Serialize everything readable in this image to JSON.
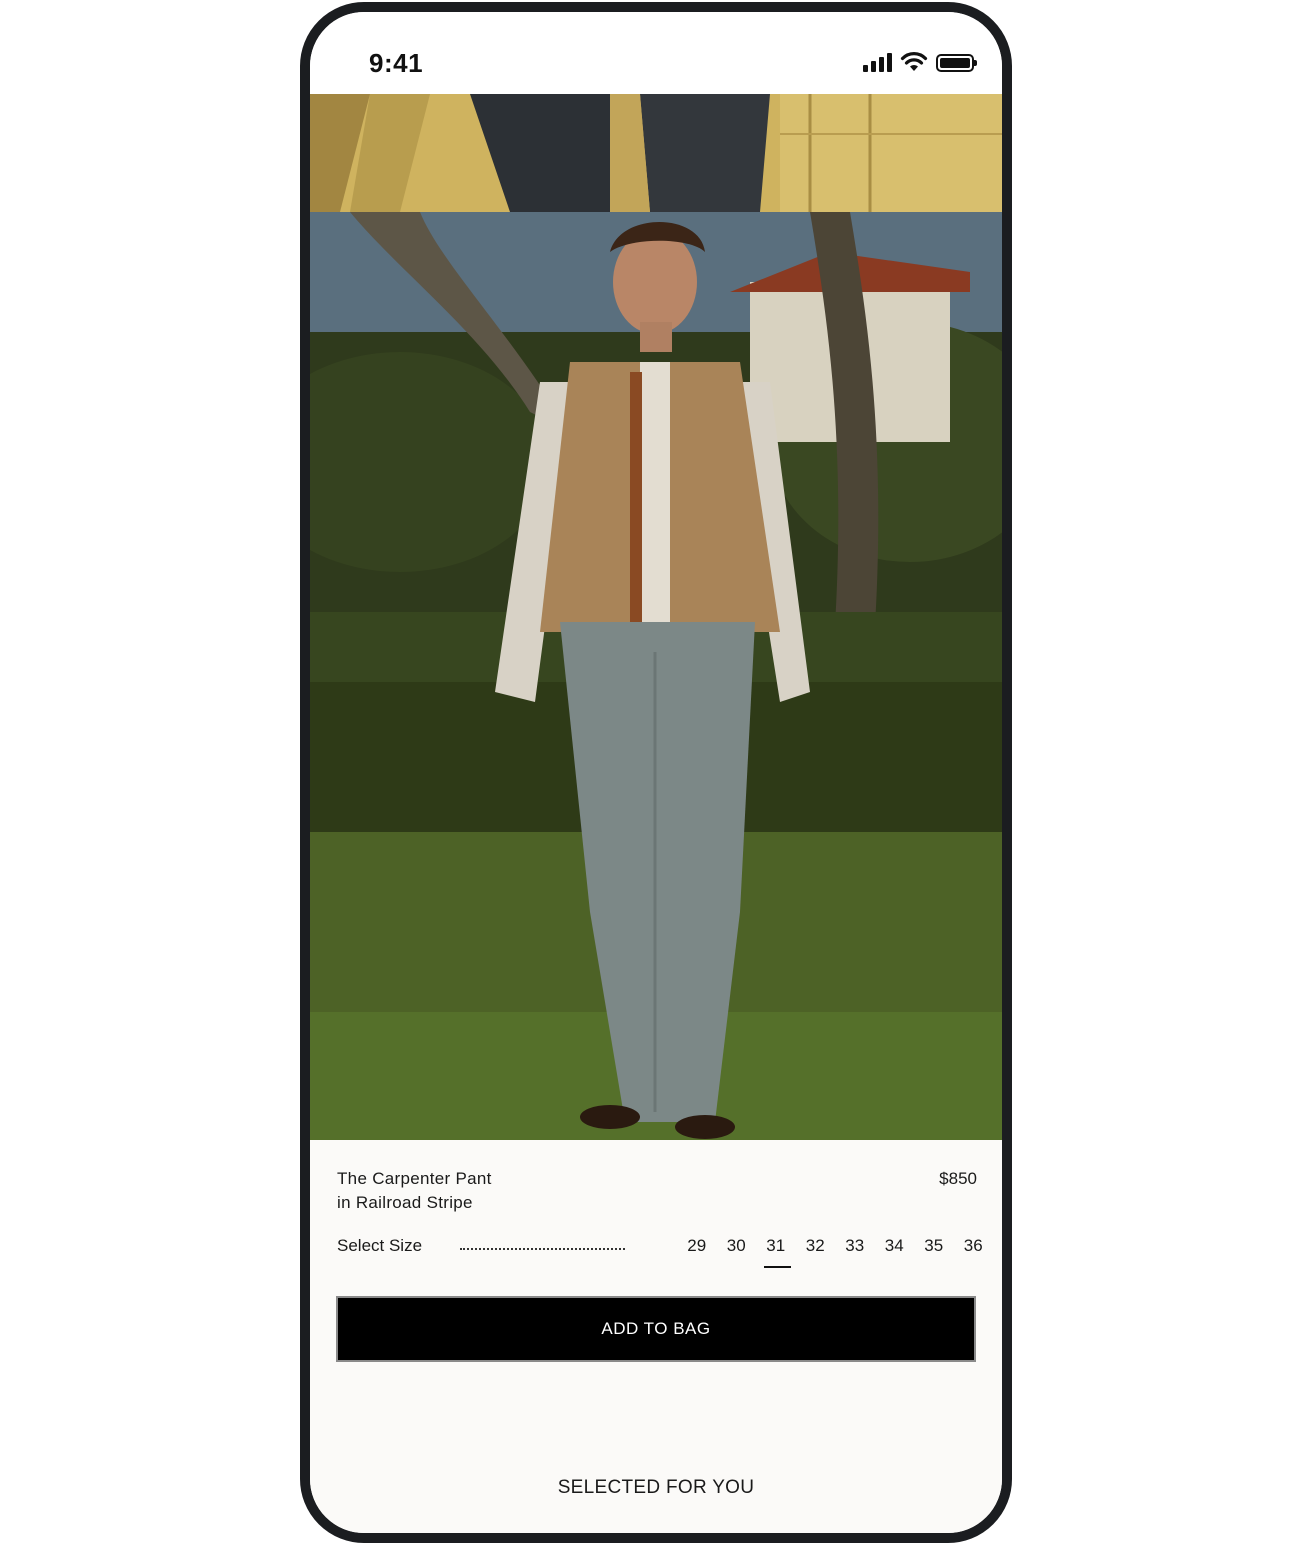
{
  "status_bar": {
    "time": "9:41",
    "icons": [
      "cellular-signal-icon",
      "wifi-icon",
      "battery-icon"
    ]
  },
  "gallery": {
    "images": [
      {
        "name": "product-photo-detail",
        "description_icon": "photo"
      },
      {
        "name": "product-photo-model",
        "description_icon": "photo"
      }
    ]
  },
  "product": {
    "name_line1": "The Carpenter Pant",
    "name_line2": "in Railroad Stripe",
    "price": "$850"
  },
  "size_selector": {
    "label": "Select Size",
    "sizes": [
      "29",
      "30",
      "31",
      "32",
      "33",
      "34",
      "35",
      "36"
    ],
    "selected": "31"
  },
  "actions": {
    "add_to_bag": "ADD TO BAG"
  },
  "sections": {
    "selected_for_you": "SELECTED FOR YOU"
  },
  "colors": {
    "primary_button": "#000000",
    "background": "#fbfaf8",
    "phone_frame": "#1b1d20"
  }
}
